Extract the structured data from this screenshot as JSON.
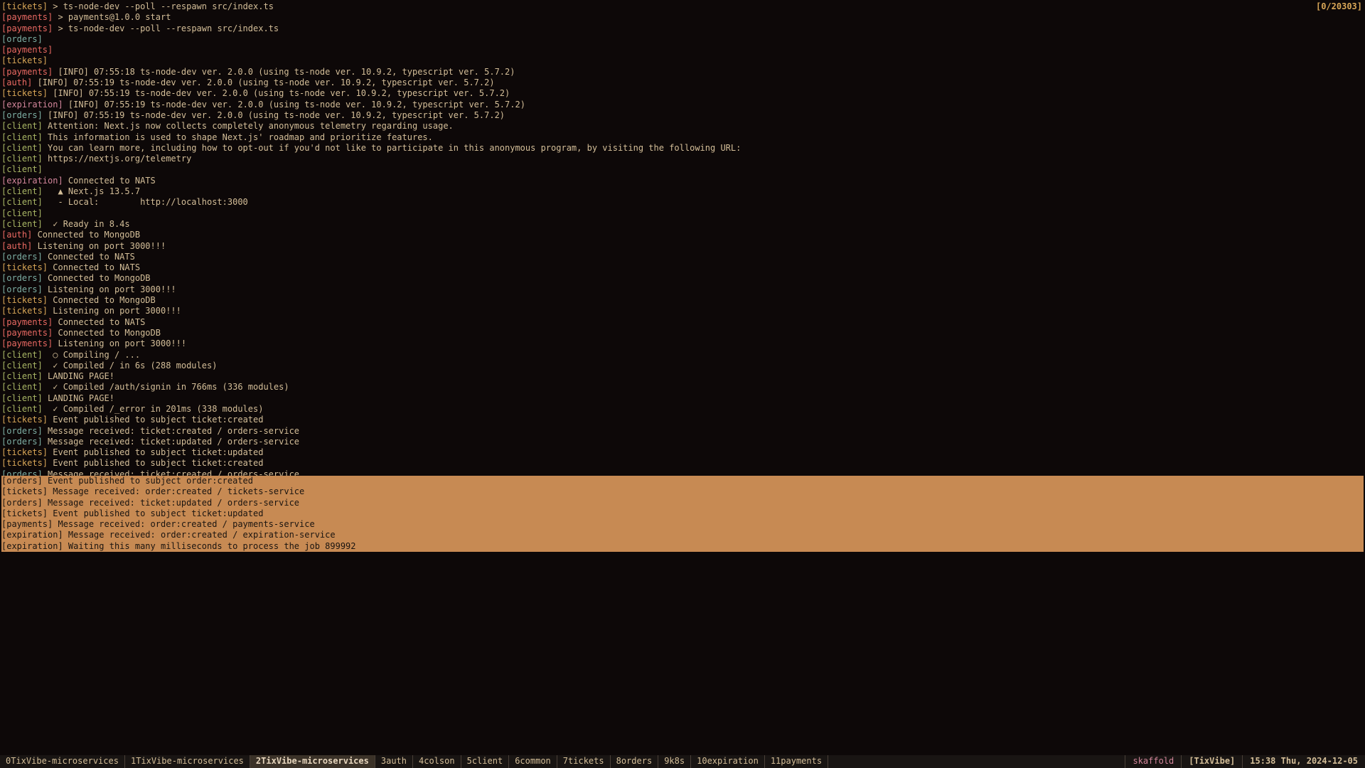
{
  "scroll_indicator": "[0/20303]",
  "lines": [
    {
      "svc": "tickets",
      "msg": " > ts-node-dev --poll --respawn src/index.ts"
    },
    {
      "svc": "payments",
      "msg": " > payments@1.0.0 start"
    },
    {
      "svc": "payments",
      "msg": " > ts-node-dev --poll --respawn src/index.ts"
    },
    {
      "svc": "orders",
      "msg": ""
    },
    {
      "svc": "payments",
      "msg": ""
    },
    {
      "svc": "tickets",
      "msg": ""
    },
    {
      "svc": "payments",
      "msg": " [INFO] 07:55:18 ts-node-dev ver. 2.0.0 (using ts-node ver. 10.9.2, typescript ver. 5.7.2)"
    },
    {
      "svc": "auth",
      "msg": " [INFO] 07:55:19 ts-node-dev ver. 2.0.0 (using ts-node ver. 10.9.2, typescript ver. 5.7.2)"
    },
    {
      "svc": "tickets",
      "msg": " [INFO] 07:55:19 ts-node-dev ver. 2.0.0 (using ts-node ver. 10.9.2, typescript ver. 5.7.2)"
    },
    {
      "svc": "expiration",
      "msg": " [INFO] 07:55:19 ts-node-dev ver. 2.0.0 (using ts-node ver. 10.9.2, typescript ver. 5.7.2)"
    },
    {
      "svc": "orders",
      "msg": " [INFO] 07:55:19 ts-node-dev ver. 2.0.0 (using ts-node ver. 10.9.2, typescript ver. 5.7.2)"
    },
    {
      "svc": "client",
      "msg": " Attention: Next.js now collects completely anonymous telemetry regarding usage."
    },
    {
      "svc": "client",
      "msg": " This information is used to shape Next.js' roadmap and prioritize features."
    },
    {
      "svc": "client",
      "msg": " You can learn more, including how to opt-out if you'd not like to participate in this anonymous program, by visiting the following URL:"
    },
    {
      "svc": "client",
      "msg": " https://nextjs.org/telemetry"
    },
    {
      "svc": "client",
      "msg": ""
    },
    {
      "svc": "expiration",
      "msg": " Connected to NATS"
    },
    {
      "svc": "client",
      "msg": "   ▲ Next.js 13.5.7"
    },
    {
      "svc": "client",
      "msg": "   - Local:        http://localhost:3000"
    },
    {
      "svc": "client",
      "msg": ""
    },
    {
      "svc": "client",
      "msg": "  ✓ Ready in 8.4s"
    },
    {
      "svc": "auth",
      "msg": " Connected to MongoDB"
    },
    {
      "svc": "auth",
      "msg": " Listening on port 3000!!!"
    },
    {
      "svc": "orders",
      "msg": " Connected to NATS"
    },
    {
      "svc": "tickets",
      "msg": " Connected to NATS"
    },
    {
      "svc": "orders",
      "msg": " Connected to MongoDB"
    },
    {
      "svc": "orders",
      "msg": " Listening on port 3000!!!"
    },
    {
      "svc": "tickets",
      "msg": " Connected to MongoDB"
    },
    {
      "svc": "tickets",
      "msg": " Listening on port 3000!!!"
    },
    {
      "svc": "payments",
      "msg": " Connected to NATS"
    },
    {
      "svc": "payments",
      "msg": " Connected to MongoDB"
    },
    {
      "svc": "payments",
      "msg": " Listening on port 3000!!!"
    },
    {
      "svc": "client",
      "msg": "  ○ Compiling / ..."
    },
    {
      "svc": "client",
      "msg": "  ✓ Compiled / in 6s (288 modules)"
    },
    {
      "svc": "client",
      "msg": " LANDING PAGE!"
    },
    {
      "svc": "client",
      "msg": "  ✓ Compiled /auth/signin in 766ms (336 modules)"
    },
    {
      "svc": "client",
      "msg": " LANDING PAGE!"
    },
    {
      "svc": "client",
      "msg": "  ✓ Compiled /_error in 201ms (338 modules)"
    },
    {
      "svc": "tickets",
      "msg": " Event published to subject ticket:created"
    },
    {
      "svc": "orders",
      "msg": " Message received: ticket:created / orders-service"
    },
    {
      "svc": "orders",
      "msg": " Message received: ticket:updated / orders-service"
    },
    {
      "svc": "tickets",
      "msg": " Event published to subject ticket:updated"
    },
    {
      "svc": "tickets",
      "msg": " Event published to subject ticket:created"
    },
    {
      "svc": "orders",
      "msg": " Message received: ticket:created / orders-service"
    }
  ],
  "highlight_lines": [
    "[orders] Event published to subject order:created",
    "[tickets] Message received: order:created / tickets-service",
    "[orders] Message received: ticket:updated / orders-service",
    "[tickets] Event published to subject ticket:updated",
    "[payments] Message received: order:created / payments-service",
    "[expiration] Message received: order:created / expiration-service",
    "[expiration] Waiting this many milliseconds to process the job 899992"
  ],
  "tabs": [
    {
      "idx": "0",
      "label": "TixVibe-microservices",
      "active": false
    },
    {
      "idx": "1",
      "label": "TixVibe-microservices",
      "active": false
    },
    {
      "idx": "2",
      "label": "TixVibe-microservices",
      "active": true
    },
    {
      "idx": "3",
      "label": "auth",
      "active": false
    },
    {
      "idx": "4",
      "label": "colson",
      "active": false
    },
    {
      "idx": "5",
      "label": "client",
      "active": false
    },
    {
      "idx": "6",
      "label": "common",
      "active": false
    },
    {
      "idx": "7",
      "label": "tickets",
      "active": false
    },
    {
      "idx": "8",
      "label": "orders",
      "active": false
    },
    {
      "idx": "9",
      "label": "k8s",
      "active": false
    },
    {
      "idx": "10",
      "label": "expiration",
      "active": false
    },
    {
      "idx": "11",
      "label": "payments",
      "active": false
    }
  ],
  "status": {
    "context": "skaffold",
    "session": "[TixVibe]",
    "datetime": "15:38 Thu, 2024-12-05"
  }
}
